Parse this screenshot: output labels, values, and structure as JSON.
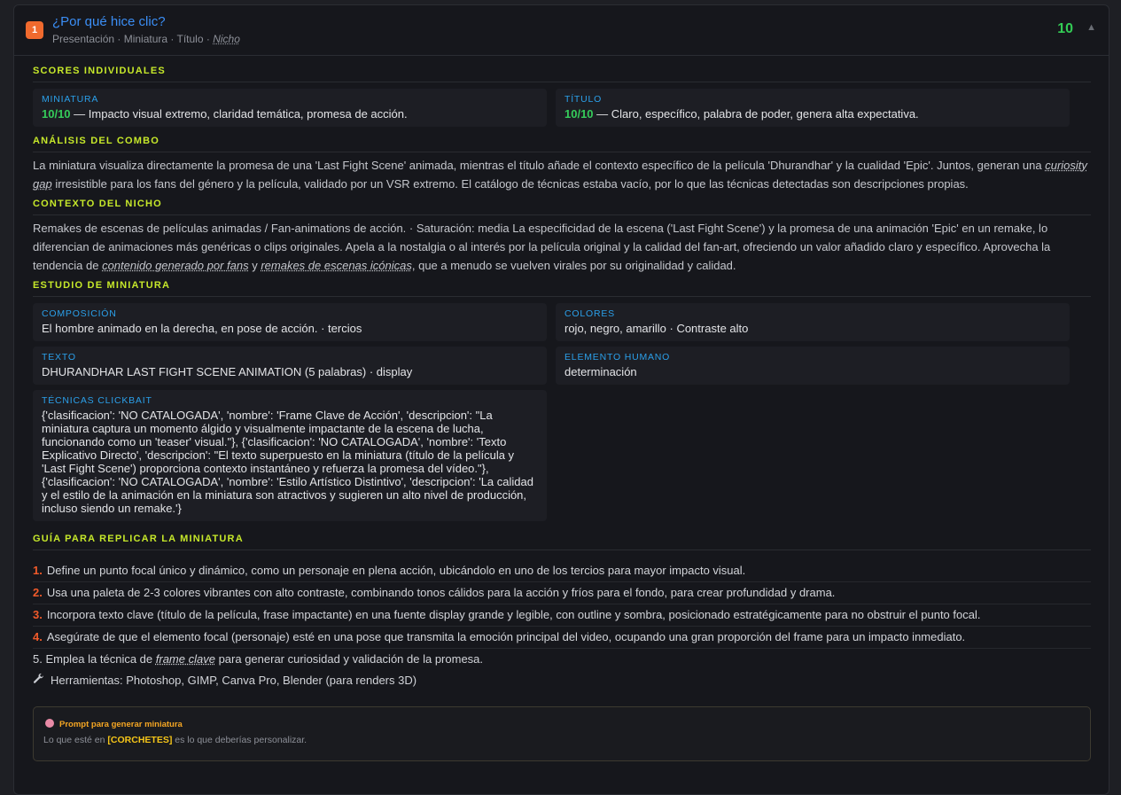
{
  "header": {
    "index": "1",
    "title": "¿Por qué hice clic?",
    "subtitle_plain": "Presentación · Miniatura · Título ·",
    "subtitle_italic": "Nicho",
    "score": "10",
    "collapse_icon": "▲"
  },
  "scores": {
    "heading": "SCORES INDIVIDUALES",
    "miniatura": {
      "label": "MINIATURA",
      "score": "10/10",
      "text": " — Impacto visual extremo, claridad temática, promesa de acción."
    },
    "titulo": {
      "label": "TÍTULO",
      "score": "10/10",
      "text": " — Claro, específico, palabra de poder, genera alta expectativa."
    }
  },
  "combo": {
    "heading": "ANÁLISIS DEL COMBO",
    "p1": "La miniatura visualiza directamente la promesa de una 'Last Fight Scene' animada, mientras el título añade el contexto específico de la película 'Dhurandhar' y la cualidad 'Epic'. Juntos, generan una ",
    "italic": "curiosity gap",
    "p2": " irresistible para los fans del género y la película, validado por un VSR extremo. El catálogo de técnicas estaba vacío, por lo que las técnicas detectadas son descripciones propias."
  },
  "nicho": {
    "heading": "CONTEXTO DEL NICHO",
    "p1": "Remakes de escenas de películas animadas / Fan-animations de acción. · Saturación: media La especificidad de la escena ('Last Fight Scene') y la promesa de una animación 'Epic' en un remake, lo diferencian de animaciones más genéricas o clips originales. Apela a la nostalgia o al interés por la película original y la calidad del fan-art, ofreciendo un valor añadido claro y específico. Aprovecha la tendencia de ",
    "italic1": "contenido generado por fans",
    "mid": " y ",
    "italic2": "remakes de escenas icónicas",
    "p2": ", que a menudo se vuelven virales por su originalidad y calidad."
  },
  "estudio": {
    "heading": "ESTUDIO DE MINIATURA",
    "composicion": {
      "label": "COMPOSICIÓN",
      "text": "El hombre animado en la derecha, en pose de acción. · tercios"
    },
    "colores": {
      "label": "COLORES",
      "text": "rojo, negro, amarillo · Contraste alto"
    },
    "texto": {
      "label": "TEXTO",
      "text": "DHURANDHAR LAST FIGHT SCENE ANIMATION (5 palabras) · display"
    },
    "humano": {
      "label": "ELEMENTO HUMANO",
      "text": "determinación"
    },
    "tecnicas": {
      "label": "TÉCNICAS CLICKBAIT",
      "text": "{'clasificacion': 'NO CATALOGADA', 'nombre': 'Frame Clave de Acción', 'descripcion': \"La miniatura captura un momento álgido y visualmente impactante de la escena de lucha, funcionando como un 'teaser' visual.\"}, {'clasificacion': 'NO CATALOGADA', 'nombre': 'Texto Explicativo Directo', 'descripcion': \"El texto superpuesto en la miniatura (título de la película y 'Last Fight Scene') proporciona contexto instantáneo y refuerza la promesa del vídeo.\"}, {'clasificacion': 'NO CATALOGADA', 'nombre': 'Estilo Artístico Distintivo', 'descripcion': 'La calidad y el estilo de la animación en la miniatura son atractivos y sugieren un alto nivel de producción, incluso siendo un remake.'}"
    }
  },
  "guia": {
    "heading": "GUÍA PARA REPLICAR LA MINIATURA",
    "items": [
      {
        "n": "1.",
        "text": "Define un punto focal único y dinámico, como un personaje en plena acción, ubicándolo en uno de los tercios para mayor impacto visual."
      },
      {
        "n": "2.",
        "text": "Usa una paleta de 2-3 colores vibrantes con alto contraste, combinando tonos cálidos para la acción y fríos para el fondo, para crear profundidad y drama."
      },
      {
        "n": "3.",
        "text": "Incorpora texto clave (título de la película, frase impactante) en una fuente display grande y legible, con outline y sombra, posicionado estratégicamente para no obstruir el punto focal."
      },
      {
        "n": "4.",
        "text": "Asegúrate de que el elemento focal (personaje) esté en una pose que transmita la emoción principal del video, ocupando una gran proporción del frame para un impacto inmediato."
      }
    ],
    "item5_a": "5. Emplea la técnica de ",
    "item5_italic": "frame clave",
    "item5_b": " para generar curiosidad y validación de la promesa.",
    "tools_icon": "wrench-icon",
    "tools": "Herramientas: Photoshop, GIMP, Canva Pro, Blender (para renders 3D)"
  },
  "prompt": {
    "icon": "brain-icon",
    "title": "Prompt para generar miniatura",
    "hint_a": "Lo que esté en ",
    "hint_bold": "[CORCHETES]",
    "hint_b": " es lo que deberías personalizar."
  },
  "colors": {
    "accent_green": "#c6e82a",
    "score_green": "#33cc55",
    "link_blue": "#3b8ef5",
    "label_blue": "#2ba0ea",
    "orange": "#f06a2e"
  }
}
